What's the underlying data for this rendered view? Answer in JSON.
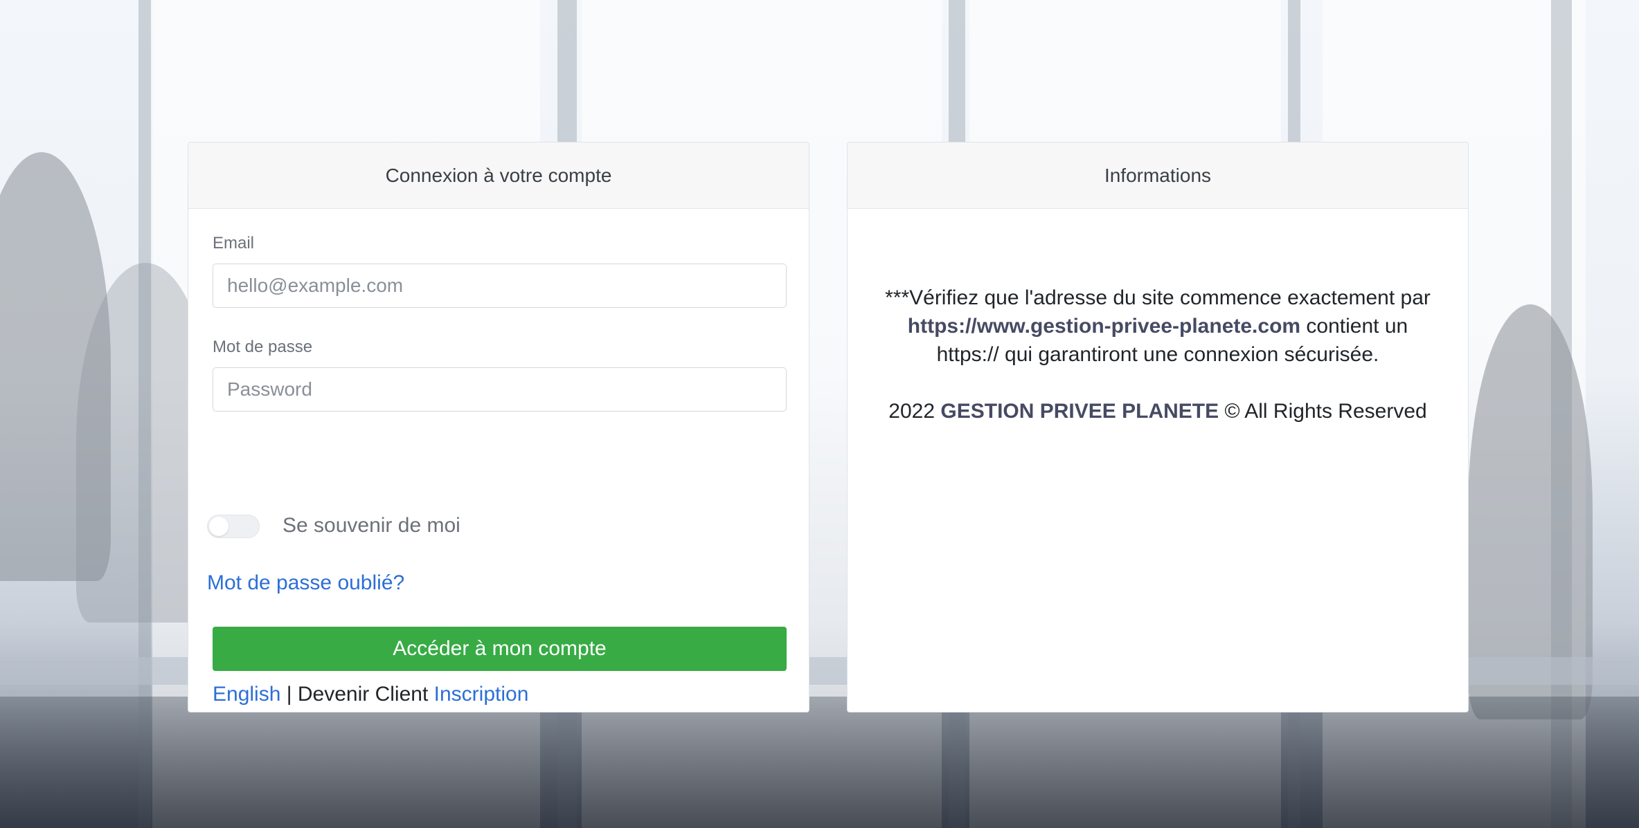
{
  "login": {
    "header": "Connexion à votre compte",
    "email_label": "Email",
    "email_placeholder": "hello@example.com",
    "password_label": "Mot de passe",
    "password_placeholder": "Password",
    "remember_label": "Se souvenir de moi",
    "forgot_link": "Mot de passe oublié?",
    "submit_label": "Accéder à mon compte",
    "language_link": "English",
    "separator": "|",
    "become_client": "Devenir Client",
    "signup_link": "Inscription"
  },
  "info": {
    "header": "Informations",
    "notice_prefix": "***Vérifiez que l'adresse du site commence exactement par",
    "notice_url": "https://www.gestion-privee-planete.com",
    "notice_suffix_1": "contient un",
    "notice_suffix_2": "https:// qui garantiront une connexion sécurisée.",
    "copyright_year": "2022",
    "copyright_company": "GESTION PRIVEE PLANETE",
    "copyright_suffix": "© All Rights Reserved"
  },
  "colors": {
    "primary_button": "#38ab45",
    "link": "#2c6fd6",
    "card_header_bg": "#f7f7f7"
  },
  "icons": [
    "toggle-switch"
  ]
}
